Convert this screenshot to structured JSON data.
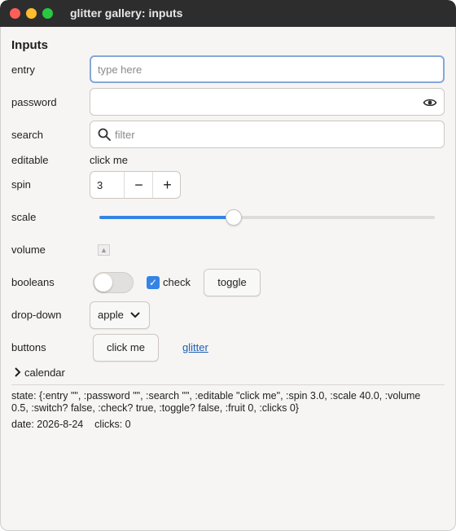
{
  "window": {
    "title": "glitter gallery: inputs"
  },
  "section_title": "Inputs",
  "labels": {
    "entry": "entry",
    "password": "password",
    "search": "search",
    "editable": "editable",
    "spin": "spin",
    "scale": "scale",
    "volume": "volume",
    "booleans": "booleans",
    "dropdown": "drop-down",
    "buttons": "buttons"
  },
  "entry": {
    "placeholder": "type here",
    "value": ""
  },
  "password": {
    "value": ""
  },
  "search": {
    "placeholder": "filter",
    "value": ""
  },
  "editable": {
    "value": "click me"
  },
  "spin": {
    "value": "3",
    "minus": "−",
    "plus": "+"
  },
  "scale": {
    "value": 40,
    "min": 0,
    "max": 100
  },
  "volume": {
    "value": 0.5,
    "icon": "speaker-icon"
  },
  "booleans": {
    "switch_on": false,
    "check_label": "check",
    "checked": true,
    "toggle_label": "toggle"
  },
  "dropdown": {
    "selected": "apple"
  },
  "buttons": {
    "button_label": "click me",
    "link_label": "glitter"
  },
  "calendar": {
    "label": "calendar"
  },
  "state_text": "state: {:entry \"\", :password \"\", :search \"\", :editable \"click me\", :spin 3.0, :scale 40.0, :volume 0.5, :switch? false, :check? true, :toggle? false, :fruit 0, :clicks 0}",
  "date_text": "date: 2026-8-24",
  "clicks_text": "clicks: 0",
  "colors": {
    "accent": "#3584e4",
    "link": "#1a5fb4",
    "titlebar": "#2d2d2d",
    "background": "#f6f5f4"
  }
}
